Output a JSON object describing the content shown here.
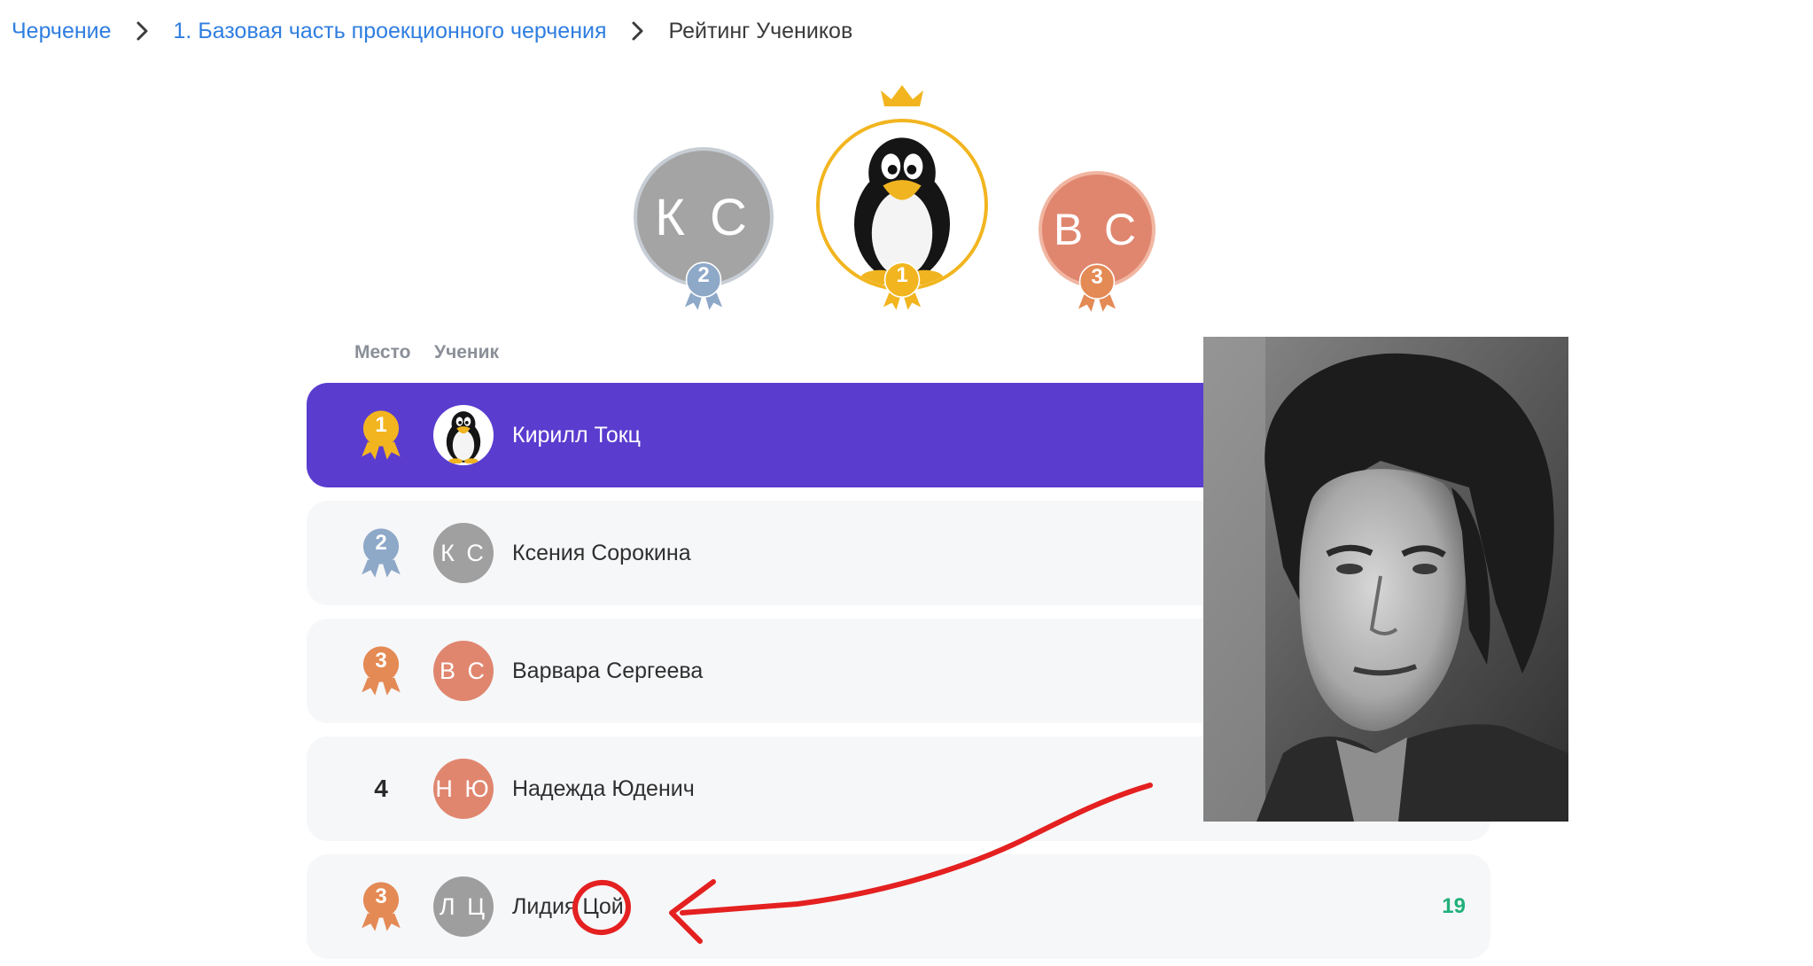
{
  "breadcrumb": {
    "items": [
      "Черчение",
      "1. Базовая часть проекционного черчения"
    ],
    "current": "Рейтинг Учеников"
  },
  "podium": [
    {
      "place": "1",
      "initials": "",
      "avatar": "penguin-avatar",
      "color": "#f2b51f"
    },
    {
      "place": "2",
      "initials": "К С",
      "color": "#a4a4a4",
      "ring": "#8ea8c8"
    },
    {
      "place": "3",
      "initials": "В С",
      "color": "#e0866f",
      "ring": "#e48a55"
    }
  ],
  "table": {
    "col_place": "Место",
    "col_student": "Ученик",
    "rows": [
      {
        "place": "1",
        "name": "Кирилл Токц",
        "initials": "",
        "avatar": "penguin-avatar",
        "score": "",
        "medal": "gold"
      },
      {
        "place": "2",
        "name": "Ксения Сорокина",
        "initials": "К С",
        "avatar_color": "#a0a0a0",
        "score": "",
        "medal": "silver"
      },
      {
        "place": "3",
        "name": "Варвара Сергеева",
        "initials": "В С",
        "avatar_color": "#e0866f",
        "score": "",
        "medal": "bronze"
      },
      {
        "place": "4",
        "name": "Надежда Юденич",
        "initials": "Н Ю",
        "avatar_color": "#e0866f",
        "score": "",
        "medal": "none"
      },
      {
        "place": "3",
        "name": "Лидия Цой",
        "initials": "Л Ц",
        "avatar_color": "#9e9e9e",
        "score": "19",
        "medal": "bronze"
      }
    ]
  },
  "colors": {
    "link": "#2f7ee0",
    "active_row": "#5a3ccf",
    "gold": "#f2b51f",
    "silver": "#8ea8c8",
    "bronze": "#e48a55",
    "score": "#21b07a",
    "annotation": "#e42020"
  }
}
